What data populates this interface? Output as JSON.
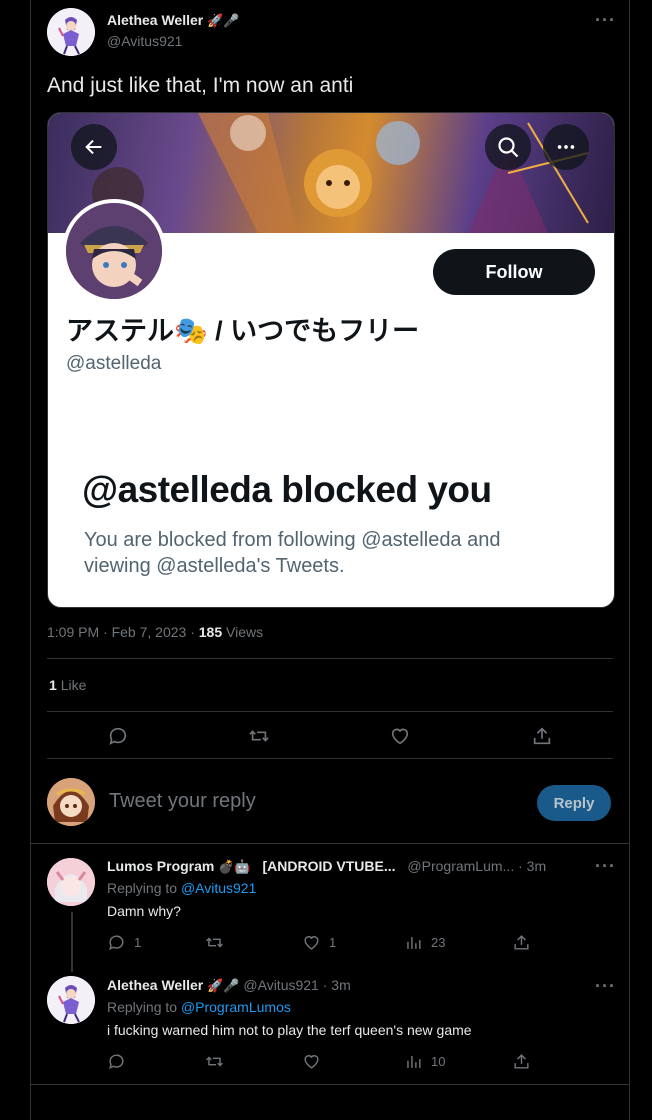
{
  "tweet": {
    "author_name": "Alethea Weller",
    "author_emoji": "🚀🎤",
    "author_handle": "@Avitus921",
    "text": "And just like that, I'm now an anti",
    "timestamp": "1:09 PM · Feb 7, 2023 ·",
    "views_count": "185",
    "views_label": "Views",
    "likes_count": "1",
    "likes_label": "Like"
  },
  "embedded_screenshot": {
    "profile_name": "アステル🎭 / いつでもフリー",
    "profile_handle": "@astelleda",
    "follow_label": "Follow",
    "blocked_title": "@astelleda blocked you",
    "blocked_body": "You are blocked from following @astelleda and viewing @astelleda's Tweets."
  },
  "reply_box": {
    "placeholder": "Tweet your reply",
    "button_label": "Reply"
  },
  "replies": [
    {
      "author_name": "Lumos Program",
      "author_emoji": "💣🤖",
      "author_suffix": "[ANDROID VTUBE...",
      "author_handle": "@ProgramLum...",
      "time": "· 3m",
      "replying_to_label": "Replying to",
      "replying_to": "@Avitus921",
      "text": "Damn why?",
      "reply_count": "1",
      "retweet_count": "",
      "like_count": "1",
      "views_count": "23"
    },
    {
      "author_name": "Alethea Weller",
      "author_emoji": "🚀🎤",
      "author_handle": "@Avitus921",
      "time": "· 3m",
      "replying_to_label": "Replying to",
      "replying_to": "@ProgramLumos",
      "text": "i fucking warned him not to play the terf queen's new game",
      "reply_count": "",
      "retweet_count": "",
      "like_count": "",
      "views_count": "10"
    }
  ],
  "colors": {
    "background": "#000000",
    "text": "#e7e9ea",
    "muted": "#71767b",
    "link": "#1d9bf0",
    "reply_button": "#1a5a8a"
  }
}
